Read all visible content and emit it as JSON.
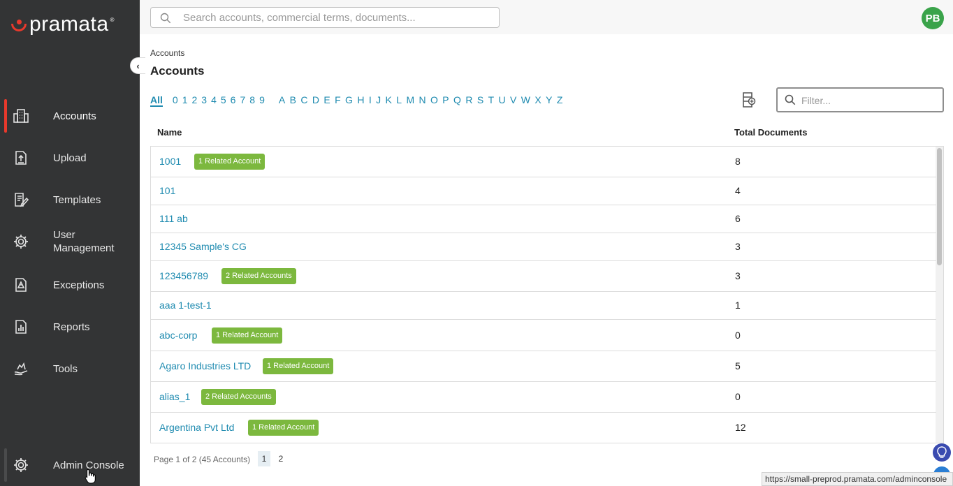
{
  "brand": {
    "name": "pramata",
    "reg": "®"
  },
  "sidebar": {
    "items": [
      {
        "label": "Accounts",
        "icon": "building-icon",
        "active": true
      },
      {
        "label": "Upload",
        "icon": "upload-icon"
      },
      {
        "label": "Templates",
        "icon": "template-icon"
      },
      {
        "label": "User\nManagement",
        "icon": "gear-icon"
      },
      {
        "label": "Exceptions",
        "icon": "warning-icon"
      },
      {
        "label": "Reports",
        "icon": "report-icon"
      },
      {
        "label": "Tools",
        "icon": "tools-icon"
      }
    ],
    "admin": {
      "label": "Admin Console",
      "icon": "gear-icon"
    }
  },
  "header": {
    "search_placeholder": "Search accounts, commercial terms, documents...",
    "avatar_initials": "PB"
  },
  "main": {
    "breadcrumb": "Accounts",
    "title": "Accounts",
    "alpha_all": "All",
    "alpha_numbers": [
      "0",
      "1",
      "2",
      "3",
      "4",
      "5",
      "6",
      "7",
      "8",
      "9"
    ],
    "alpha_letters": [
      "A",
      "B",
      "C",
      "D",
      "E",
      "F",
      "G",
      "H",
      "I",
      "J",
      "K",
      "L",
      "M",
      "N",
      "O",
      "P",
      "Q",
      "R",
      "S",
      "T",
      "U",
      "V",
      "W",
      "X",
      "Y",
      "Z"
    ],
    "filter_placeholder": "Filter...",
    "columns": {
      "name": "Name",
      "docs": "Total Documents"
    },
    "rows": [
      {
        "name": "1001",
        "badge": "1 Related Account",
        "docs": "8"
      },
      {
        "name": "101",
        "badge": "",
        "docs": "4"
      },
      {
        "name": "111 ab",
        "badge": "",
        "docs": "6"
      },
      {
        "name": "12345 Sample's CG",
        "badge": "",
        "docs": "3"
      },
      {
        "name": "123456789",
        "badge": "2 Related Accounts",
        "docs": "3"
      },
      {
        "name": "aaa 1-test-1",
        "badge": "",
        "docs": "1"
      },
      {
        "name": "abc-corp",
        "badge": "1 Related Account",
        "docs": "0"
      },
      {
        "name": "Agaro Industries LTD",
        "badge": "1 Related Account",
        "docs": "5"
      },
      {
        "name": "alias_1",
        "badge": "2 Related Accounts",
        "docs": "0"
      },
      {
        "name": "Argentina Pvt Ltd",
        "badge": "1 Related Account",
        "docs": "12"
      }
    ],
    "pagination": {
      "info": "Page 1 of 2 (45 Accounts)",
      "pages": [
        "1",
        "2"
      ],
      "current": "1"
    }
  },
  "status_url": "https://small-preprod.pramata.com/adminconsole",
  "colors": {
    "sidebar": "#333435",
    "accent": "#e8392c",
    "link": "#1f8bb0",
    "badge": "#7cb83e",
    "avatar": "#3aa34a"
  }
}
